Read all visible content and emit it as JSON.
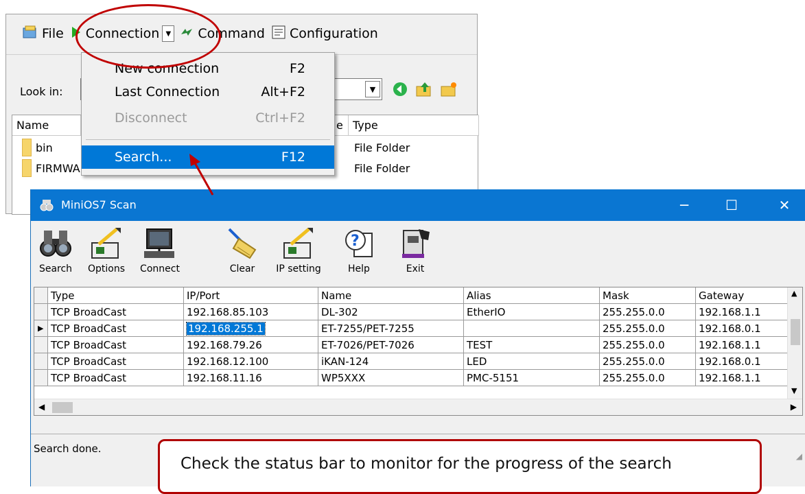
{
  "menubar": {
    "file_label": "File",
    "connection_label": "Connection",
    "command_label": "Command",
    "configuration_label": "Configuration"
  },
  "lookin": {
    "label": "Look in:"
  },
  "file_list": {
    "headers": [
      "Name",
      "e",
      "Type"
    ],
    "rows": [
      {
        "name": "bin",
        "type": "File Folder"
      },
      {
        "name": "FIRMWARE",
        "type": "File Folder"
      }
    ]
  },
  "connection_menu": {
    "items": [
      {
        "label": "New connection",
        "shortcut": "F2"
      },
      {
        "label": "Last Connection",
        "shortcut": "Alt+F2"
      },
      {
        "label": "Disconnect",
        "shortcut": "Ctrl+F2"
      },
      {
        "label": "Search...",
        "shortcut": "F12"
      }
    ]
  },
  "scan_window": {
    "title": "MiniOS7 Scan",
    "toolbar": [
      "Search",
      "Options",
      "Connect",
      "Clear",
      "IP setting",
      "Help",
      "Exit"
    ],
    "columns": [
      "Type",
      "IP/Port",
      "Name",
      "Alias",
      "Mask",
      "Gateway"
    ],
    "rows": [
      {
        "type": "TCP BroadCast",
        "ip": "192.168.85.103",
        "name": "DL-302",
        "alias": "EtherIO",
        "mask": "255.255.0.0",
        "gateway": "192.168.1.1"
      },
      {
        "type": "TCP BroadCast",
        "ip": "192.168.255.1",
        "name": "ET-7255/PET-7255",
        "alias": "",
        "mask": "255.255.0.0",
        "gateway": "192.168.0.1"
      },
      {
        "type": "TCP BroadCast",
        "ip": "192.168.79.26",
        "name": "ET-7026/PET-7026",
        "alias": "TEST",
        "mask": "255.255.0.0",
        "gateway": "192.168.1.1"
      },
      {
        "type": "TCP BroadCast",
        "ip": "192.168.12.100",
        "name": "iKAN-124",
        "alias": "LED",
        "mask": "255.255.0.0",
        "gateway": "192.168.0.1"
      },
      {
        "type": "TCP BroadCast",
        "ip": "192.168.11.16",
        "name": "WP5XXX",
        "alias": "PMC-5151",
        "mask": "255.255.0.0",
        "gateway": "192.168.1.1"
      }
    ],
    "status": "Search done."
  },
  "callout": {
    "text": "Check the status bar to monitor for the progress of the search"
  },
  "colors": {
    "title_bar": "#0a76d2",
    "selection": "#0078d7",
    "annotation_red": "#c00000"
  }
}
